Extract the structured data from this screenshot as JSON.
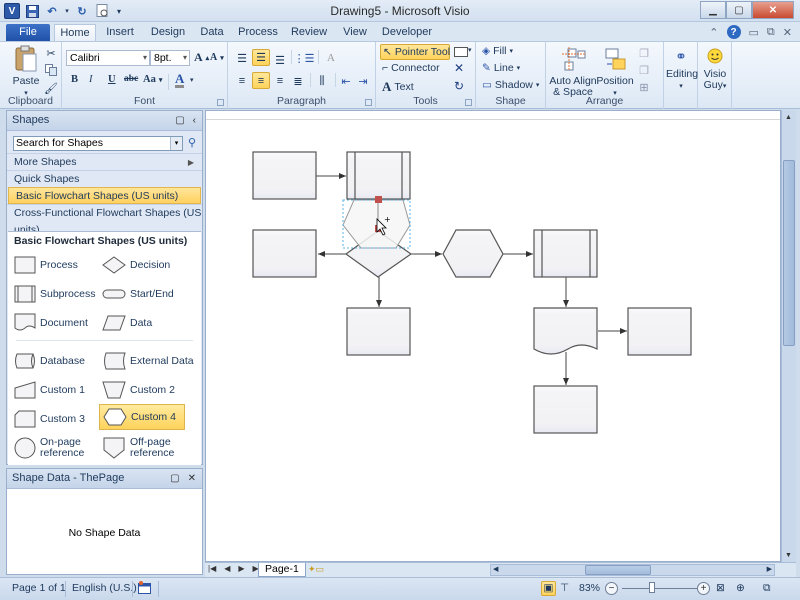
{
  "window": {
    "title": "Drawing5 - Microsoft Visio",
    "app_icon": "V",
    "quick_access": [
      "save-icon",
      "undo-icon",
      "redo-icon",
      "print-preview-icon",
      "customize-qat-icon"
    ]
  },
  "tabs": [
    {
      "label": "File"
    },
    {
      "label": "Home"
    },
    {
      "label": "Insert"
    },
    {
      "label": "Design"
    },
    {
      "label": "Data"
    },
    {
      "label": "Process"
    },
    {
      "label": "Review"
    },
    {
      "label": "View"
    },
    {
      "label": "Developer"
    }
  ],
  "ribbon": {
    "clipboard": {
      "label": "Clipboard",
      "paste": "Paste"
    },
    "font": {
      "label": "Font",
      "font_name": "Calibri",
      "font_size": "8pt.",
      "bold": "B",
      "italic": "I",
      "underline": "U",
      "strike": "abc",
      "case": "Aa",
      "color": "A"
    },
    "paragraph": {
      "label": "Paragraph"
    },
    "tools": {
      "label": "Tools",
      "pointer": "Pointer Tool",
      "connector": "Connector",
      "text": "Text"
    },
    "shape": {
      "label": "Shape",
      "fill": "Fill",
      "line": "Line",
      "shadow": "Shadow"
    },
    "arrange": {
      "label": "Arrange",
      "auto_align": "Auto Align",
      "auto_align2": "& Space",
      "position": "Position"
    },
    "editing": {
      "label": "Editing"
    },
    "visioguy": {
      "label": "Visio",
      "label2": "Guy"
    }
  },
  "shapes_panel": {
    "title": "Shapes",
    "search_placeholder": "Search for Shapes",
    "nav": [
      {
        "label": "More Shapes"
      },
      {
        "label": "Quick Shapes"
      },
      {
        "label": "Basic Flowchart Shapes (US units)",
        "selected": true
      },
      {
        "label": "Cross-Functional Flowchart Shapes (US units)"
      }
    ],
    "stencil_title": "Basic Flowchart Shapes (US units)",
    "shapes": [
      {
        "label": "Process"
      },
      {
        "label": "Decision"
      },
      {
        "label": "Subprocess"
      },
      {
        "label": "Start/End"
      },
      {
        "label": "Document"
      },
      {
        "label": "Data"
      },
      {
        "label": "Database"
      },
      {
        "label": "External Data"
      },
      {
        "label": "Custom 1"
      },
      {
        "label": "Custom 2"
      },
      {
        "label": "Custom 3"
      },
      {
        "label": "Custom 4",
        "highlighted": true
      },
      {
        "label": "On-page",
        "label2": "reference"
      },
      {
        "label": "Off-page",
        "label2": "reference"
      }
    ]
  },
  "shape_data_panel": {
    "title": "Shape Data - ThePage",
    "empty_text": "No Shape Data"
  },
  "canvas": {
    "page_tab": "Page-1",
    "shapes": [
      {
        "type": "process",
        "id": "p1"
      },
      {
        "type": "subprocess",
        "id": "s1"
      },
      {
        "type": "hexagon",
        "id": "h-drag",
        "state": "being-dragged"
      },
      {
        "type": "process",
        "id": "p2"
      },
      {
        "type": "decision",
        "id": "d1"
      },
      {
        "type": "hexagon",
        "id": "h1"
      },
      {
        "type": "subprocess",
        "id": "s2"
      },
      {
        "type": "process",
        "id": "p3"
      },
      {
        "type": "document",
        "id": "doc1"
      },
      {
        "type": "process",
        "id": "p4"
      },
      {
        "type": "process",
        "id": "p5"
      }
    ]
  },
  "statusbar": {
    "page": "Page 1 of 1",
    "language": "English (U.S.)",
    "zoom": "83%",
    "zoom_value_percent": 83
  },
  "colors": {
    "accent_highlight": "#ffd35c",
    "file_tab": "#2a5cb4",
    "connection_point": "#c0504d",
    "selection": "#59b5e8"
  }
}
